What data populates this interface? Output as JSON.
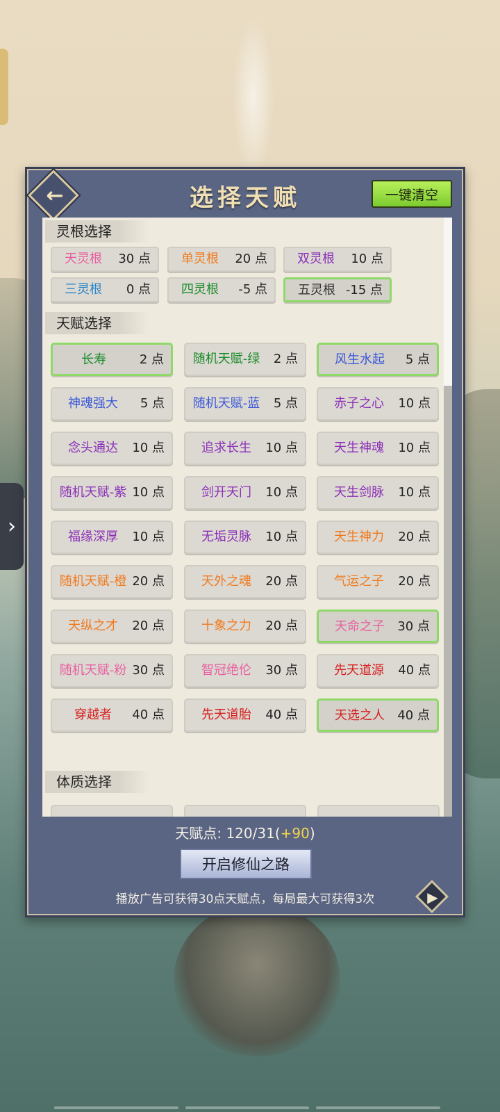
{
  "header": {
    "title": "选择天赋",
    "clear_label": "一键清空"
  },
  "sections": {
    "root": "灵根选择",
    "talent": "天赋选择",
    "body": "体质选择"
  },
  "roots": [
    {
      "name": "天灵根",
      "pts": "30 点",
      "color": "#e85fa0",
      "selected": false
    },
    {
      "name": "单灵根",
      "pts": "20 点",
      "color": "#ef7a1f",
      "selected": false
    },
    {
      "name": "双灵根",
      "pts": "10 点",
      "color": "#8b2fb8",
      "selected": false
    },
    {
      "name": "三灵根",
      "pts": "0 点",
      "color": "#2a86c8",
      "selected": false
    },
    {
      "name": "四灵根",
      "pts": "-5 点",
      "color": "#1a8a2a",
      "selected": false
    },
    {
      "name": "五灵根",
      "pts": "-15 点",
      "color": "#333333",
      "selected": true
    }
  ],
  "talents": [
    {
      "name": "长寿",
      "pts": "2 点",
      "color": "#1a8a2a",
      "selected": true
    },
    {
      "name": "随机天赋-绿",
      "pts": "2 点",
      "color": "#1a8a2a",
      "selected": false
    },
    {
      "name": "风生水起",
      "pts": "5 点",
      "color": "#3a57d8",
      "selected": true
    },
    {
      "name": "神魂强大",
      "pts": "5 点",
      "color": "#3a57d8",
      "selected": false
    },
    {
      "name": "随机天赋-蓝",
      "pts": "5 点",
      "color": "#3a57d8",
      "selected": false
    },
    {
      "name": "赤子之心",
      "pts": "10 点",
      "color": "#8b2fb8",
      "selected": false
    },
    {
      "name": "念头通达",
      "pts": "10 点",
      "color": "#8b2fb8",
      "selected": false
    },
    {
      "name": "追求长生",
      "pts": "10 点",
      "color": "#8b2fb8",
      "selected": false
    },
    {
      "name": "天生神魂",
      "pts": "10 点",
      "color": "#8b2fb8",
      "selected": false
    },
    {
      "name": "随机天赋-紫",
      "pts": "10 点",
      "color": "#8b2fb8",
      "selected": false
    },
    {
      "name": "剑开天门",
      "pts": "10 点",
      "color": "#8b2fb8",
      "selected": false
    },
    {
      "name": "天生剑脉",
      "pts": "10 点",
      "color": "#8b2fb8",
      "selected": false
    },
    {
      "name": "福缘深厚",
      "pts": "10 点",
      "color": "#8b2fb8",
      "selected": false
    },
    {
      "name": "无垢灵脉",
      "pts": "10 点",
      "color": "#8b2fb8",
      "selected": false
    },
    {
      "name": "天生神力",
      "pts": "20 点",
      "color": "#ef7a1f",
      "selected": false
    },
    {
      "name": "随机天赋-橙",
      "pts": "20 点",
      "color": "#ef7a1f",
      "selected": false
    },
    {
      "name": "天外之魂",
      "pts": "20 点",
      "color": "#ef7a1f",
      "selected": false
    },
    {
      "name": "气运之子",
      "pts": "20 点",
      "color": "#ef7a1f",
      "selected": false
    },
    {
      "name": "天纵之才",
      "pts": "20 点",
      "color": "#ef7a1f",
      "selected": false
    },
    {
      "name": "十象之力",
      "pts": "20 点",
      "color": "#ef7a1f",
      "selected": false
    },
    {
      "name": "天命之子",
      "pts": "30 点",
      "color": "#e85fa0",
      "selected": true
    },
    {
      "name": "随机天赋-粉",
      "pts": "30 点",
      "color": "#e85fa0",
      "selected": false
    },
    {
      "name": "智冠绝伦",
      "pts": "30 点",
      "color": "#e85fa0",
      "selected": false
    },
    {
      "name": "先天道源",
      "pts": "40 点",
      "color": "#d61f1f",
      "selected": false
    },
    {
      "name": "穿越者",
      "pts": "40 点",
      "color": "#d61f1f",
      "selected": false
    },
    {
      "name": "先天道胎",
      "pts": "40 点",
      "color": "#d61f1f",
      "selected": false
    },
    {
      "name": "天选之人",
      "pts": "40 点",
      "color": "#d61f1f",
      "selected": true
    }
  ],
  "footer": {
    "points_label": "天赋点:",
    "points_value": "120/31",
    "points_bonus_open": "(",
    "points_bonus": "+90",
    "points_bonus_close": ")",
    "start_label": "开启修仙之路",
    "ad_note": "播放广告可获得30点天赋点，每局最大可获得3次"
  },
  "icons": {
    "back": "back-arrow-icon",
    "side": "chevron-right-icon",
    "play": "play-icon"
  }
}
